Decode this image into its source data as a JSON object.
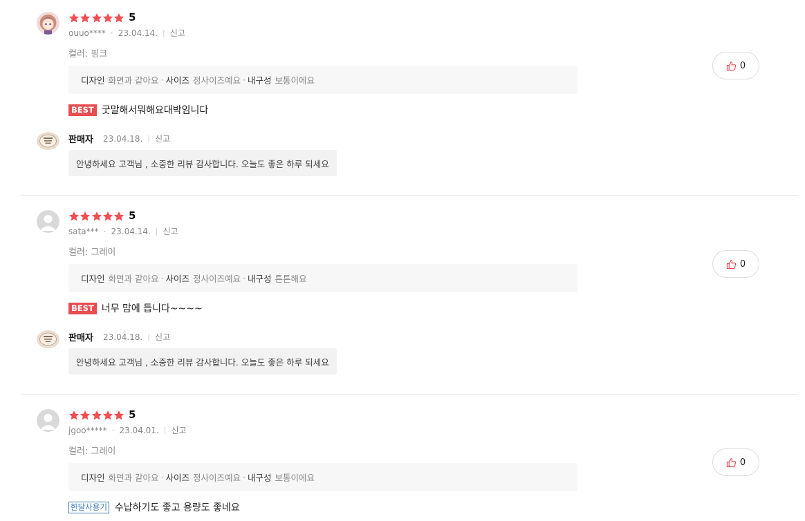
{
  "reviews": [
    {
      "rating": "5",
      "user": "ouuo****",
      "date": "23.04.14.",
      "report": "신고",
      "option": "컬러: 핑크",
      "survey": [
        {
          "q": "디자인",
          "a": "화면과 같아요"
        },
        {
          "q": "사이즈",
          "a": "정사이즈예요"
        },
        {
          "q": "내구성",
          "a": "보통이에요"
        }
      ],
      "badge": "BEST",
      "text": "굿말해서뭐해요대박임니다",
      "likes": "0",
      "seller": {
        "name": "판매자",
        "date": "23.04.18.",
        "report": "신고",
        "reply": "안녕하세요 고객님 , 소중한 리뷰 감사합니다. 오늘도 좋은 하루 되세요"
      }
    },
    {
      "rating": "5",
      "user": "sata***",
      "date": "23.04.14.",
      "report": "신고",
      "option": "컬러: 그레이",
      "survey": [
        {
          "q": "디자인",
          "a": "화면과 같아요"
        },
        {
          "q": "사이즈",
          "a": "정사이즈예요"
        },
        {
          "q": "내구성",
          "a": "튼튼해요"
        }
      ],
      "badge": "BEST",
      "text": "너무 맘에 듭니다~~~~",
      "likes": "0",
      "seller": {
        "name": "판매자",
        "date": "23.04.18.",
        "report": "신고",
        "reply": "안녕하세요 고객님 , 소중한 리뷰 감사합니다. 오늘도 좋은 하루 되세요"
      }
    },
    {
      "rating": "5",
      "user": "jgoo*****",
      "date": "23.04.01.",
      "report": "신고",
      "option": "컬러: 그레이",
      "survey": [
        {
          "q": "디자인",
          "a": "화면과 같아요"
        },
        {
          "q": "사이즈",
          "a": "정사이즈예요"
        },
        {
          "q": "내구성",
          "a": "보통이에요"
        }
      ],
      "badge": "한달사용기",
      "text": "수납하기도 좋고 용량도 좋네요",
      "likes": "0"
    }
  ],
  "colors": {
    "star": "#f04f54",
    "best_badge": "#e84d51",
    "month_badge": "#3a79b6",
    "thumb_icon": "#e8484c"
  }
}
